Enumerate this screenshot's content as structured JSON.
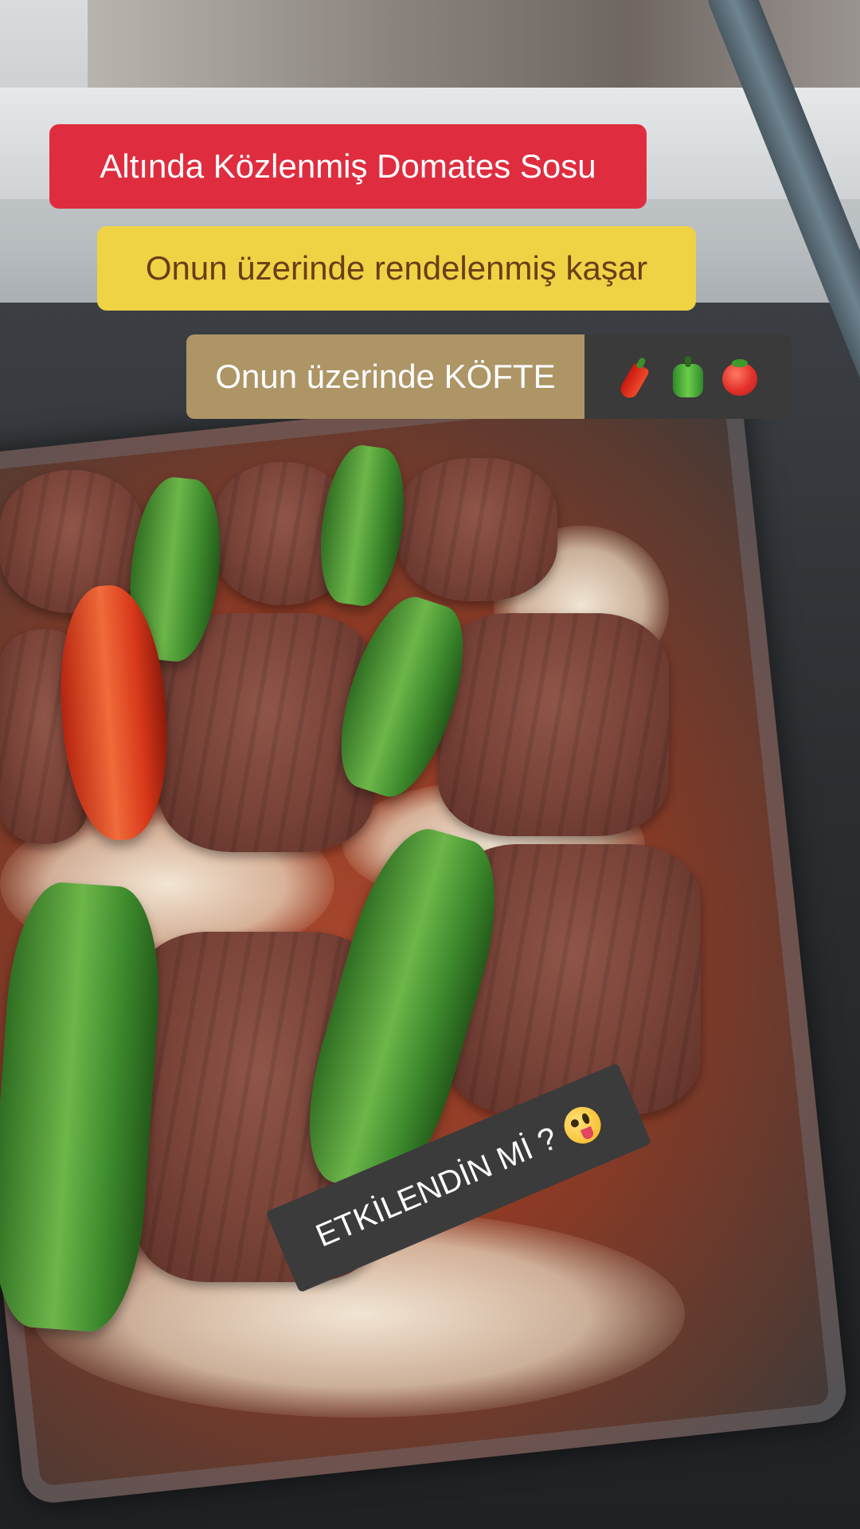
{
  "captions": {
    "line1": "Altında Közlenmiş Domates Sosu",
    "line2": "Onun üzerinde rendelenmiş kaşar",
    "line3": "Onun üzerinde KÖFTE",
    "line3_emojis": [
      "hot-pepper-icon",
      "bell-pepper-icon",
      "tomato-icon"
    ],
    "line4": "ETKİLENDİN Mİ ?",
    "line4_emoji": "zany-face-icon"
  },
  "colors": {
    "caption1_bg": "#df2d3f",
    "caption2_bg": "#f0d245",
    "caption2_text": "#6b3d16",
    "caption3_bg": "#ad9566",
    "emoji_bg": "#3a3a3a",
    "caption4_bg": "#3b3b3b"
  }
}
